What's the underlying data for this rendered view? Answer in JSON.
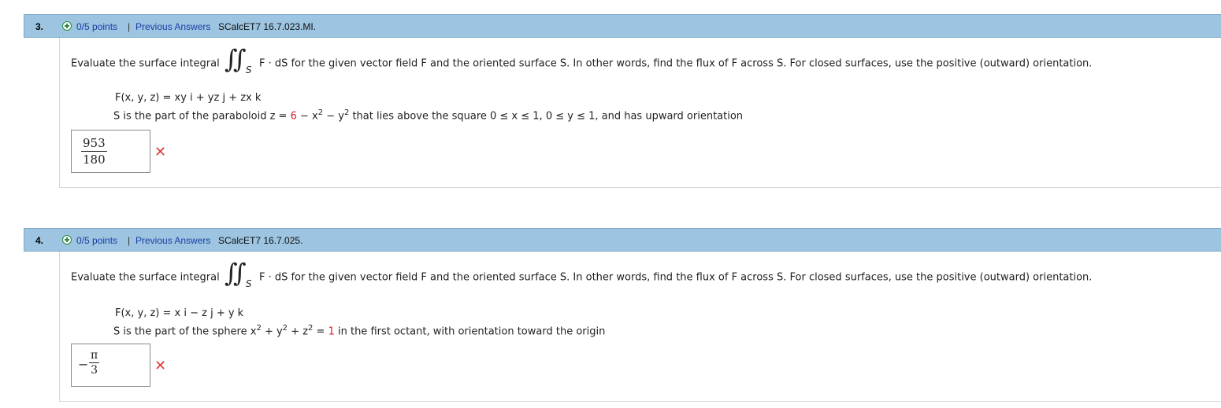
{
  "questions": [
    {
      "number": "3.",
      "points": "0/5 points",
      "separator": "|",
      "previous_answers": "Previous Answers",
      "code": "SCalcET7 16.7.023.MI.",
      "prompt_before": "Evaluate the surface integral",
      "integral_sub": "S",
      "prompt_after": "F · dS  for the given vector field F and the oriented surface S. In other words, find the flux of F across S. For closed surfaces, use the positive (outward) orientation.",
      "field": "F(x, y, z) = xy i + yz j + zx k",
      "surface_before": "S is the part of the paraboloid  z = ",
      "surface_red": "6",
      "surface_after": " − x",
      "surface_rest": " − y",
      "surface_end": " that lies above the square 0 ≤ x ≤ 1, 0 ≤ y ≤ 1,  and has upward orientation",
      "sup": "2",
      "answer_sign": "",
      "answer_num": "953",
      "answer_den": "180",
      "result_icon": "✕"
    },
    {
      "number": "4.",
      "points": "0/5 points",
      "separator": "|",
      "previous_answers": "Previous Answers",
      "code": "SCalcET7 16.7.025.",
      "prompt_before": "Evaluate the surface integral",
      "integral_sub": "S",
      "prompt_after": "F · dS  for the given vector field F and the oriented surface S. In other words, find the flux of F across S. For closed surfaces, use the positive (outward) orientation.",
      "field": "F(x, y, z) = x i − z j + y k",
      "surface_before": "S is the part of the sphere  x",
      "surface_mid1": " + y",
      "surface_mid2": " + z",
      "surface_eq": " = ",
      "surface_red": "1",
      "surface_end": "  in the first octant, with orientation toward the origin",
      "sup": "2",
      "answer_sign": "−",
      "answer_num": "π",
      "answer_den": "3",
      "result_icon": "✕"
    }
  ]
}
